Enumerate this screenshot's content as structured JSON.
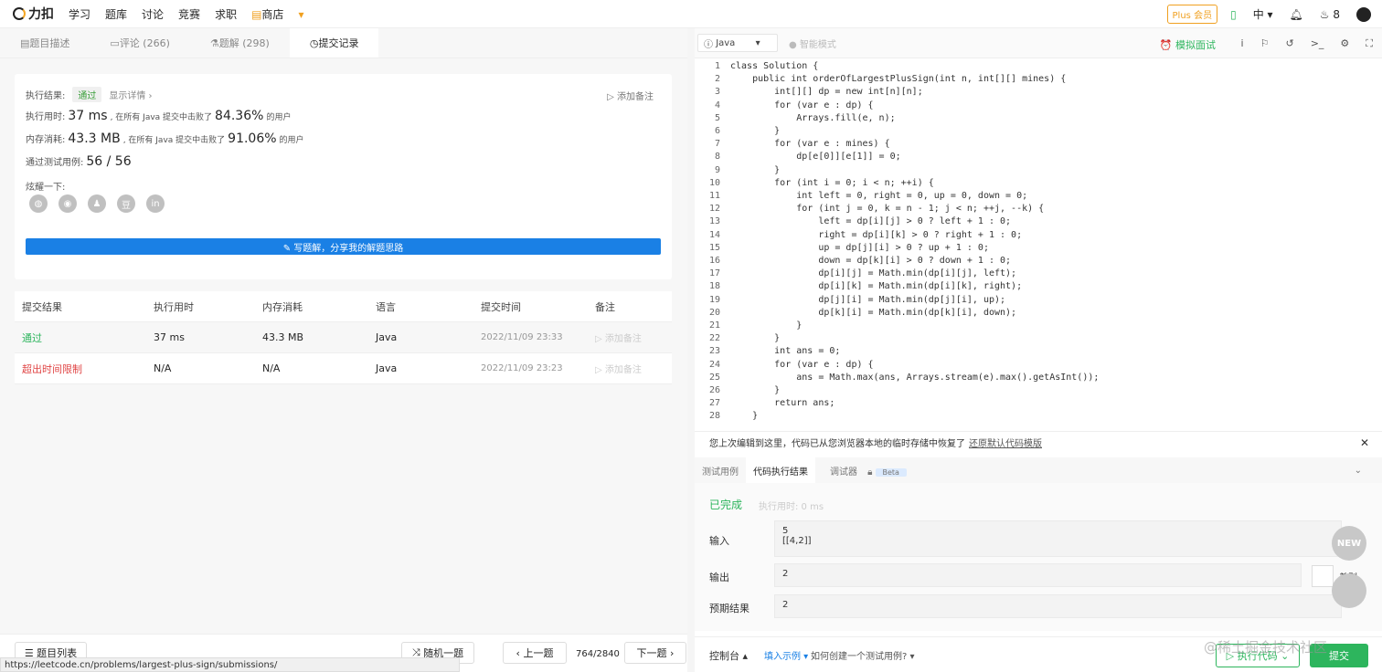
{
  "topbar": {
    "logo": "力扣",
    "nav": [
      "学习",
      "题库",
      "讨论",
      "竞赛",
      "求职",
      "商店"
    ],
    "plus": "Plus 会员",
    "lang": "中",
    "points": "8"
  },
  "tabs": [
    {
      "label": "题目描述"
    },
    {
      "label": "评论 (266)"
    },
    {
      "label": "题解 (298)"
    },
    {
      "label": "提交记录"
    }
  ],
  "result": {
    "status_label": "执行结果:",
    "status": "通过",
    "details": "显示详情 ›",
    "add_note": "添加备注",
    "time_label": "执行用时:",
    "time_value": "37 ms",
    "time_text": ", 在所有 Java 提交中击败了",
    "time_pct": "84.36%",
    "users": "的用户",
    "mem_label": "内存消耗:",
    "mem_value": "43.3 MB",
    "mem_text": ", 在所有 Java 提交中击败了",
    "mem_pct": "91.06%",
    "tests_label": "通过测试用例:",
    "tests_value": "56 / 56",
    "share_label": "炫耀一下:",
    "write_btn": "✎ 写题解，分享我的解题思路"
  },
  "table": {
    "headers": [
      "提交结果",
      "执行用时",
      "内存消耗",
      "语言",
      "提交时间",
      "备注"
    ],
    "rows": [
      {
        "result": "通过",
        "time": "37 ms",
        "mem": "43.3 MB",
        "lang": "Java",
        "date": "2022/11/09 23:33",
        "note": "添加备注"
      },
      {
        "result": "超出时间限制",
        "time": "N/A",
        "mem": "N/A",
        "lang": "Java",
        "date": "2022/11/09 23:23",
        "note": "添加备注"
      }
    ]
  },
  "bottom_left": {
    "list": "题目列表",
    "random": "随机一题",
    "prev": "上一题",
    "page": "764/2840",
    "next": "下一题"
  },
  "url": "https://leetcode.cn/problems/largest-plus-sign/submissions/",
  "editor": {
    "language": "Java",
    "smart_mode": "智能模式",
    "mock": "模拟面试",
    "lines": [
      "class Solution {",
      "    public int orderOfLargestPlusSign(int n, int[][] mines) {",
      "        int[][] dp = new int[n][n];",
      "        for (var e : dp) {",
      "            Arrays.fill(e, n);",
      "        }",
      "        for (var e : mines) {",
      "            dp[e[0]][e[1]] = 0;",
      "        }",
      "        for (int i = 0; i < n; ++i) {",
      "            int left = 0, right = 0, up = 0, down = 0;",
      "            for (int j = 0, k = n - 1; j < n; ++j, --k) {",
      "                left = dp[i][j] > 0 ? left + 1 : 0;",
      "                right = dp[i][k] > 0 ? right + 1 : 0;",
      "                up = dp[j][i] > 0 ? up + 1 : 0;",
      "                down = dp[k][i] > 0 ? down + 1 : 0;",
      "                dp[i][j] = Math.min(dp[i][j], left);",
      "                dp[i][k] = Math.min(dp[i][k], right);",
      "                dp[j][i] = Math.min(dp[j][i], up);",
      "                dp[k][i] = Math.min(dp[k][i], down);",
      "            }",
      "        }",
      "        int ans = 0;",
      "        for (var e : dp) {",
      "            ans = Math.max(ans, Arrays.stream(e).max().getAsInt());",
      "        }",
      "        return ans;",
      "    }",
      "}"
    ]
  },
  "restore": {
    "text": "您上次编辑到这里，代码已从您浏览器本地的临时存储中恢复了",
    "link": "还原默认代码模版"
  },
  "result_tabs": [
    "测试用例",
    "代码执行结果",
    "调试器"
  ],
  "beta": "Beta",
  "run_result": {
    "done": "已完成",
    "exec_time": "执行用时: 0 ms",
    "input_label": "输入",
    "input": "5\n[[4,2]]",
    "output_label": "输出",
    "output": "2",
    "expected_label": "预期结果",
    "expected": "2",
    "diff": "差别"
  },
  "bottom_right": {
    "console": "控制台 ▴",
    "fill": "填入示例",
    "howto": "如何创建一个测试用例?",
    "run": "执行代码",
    "submit": "提交",
    "new": "NEW"
  },
  "watermark": "@稀土掘金技术社区"
}
